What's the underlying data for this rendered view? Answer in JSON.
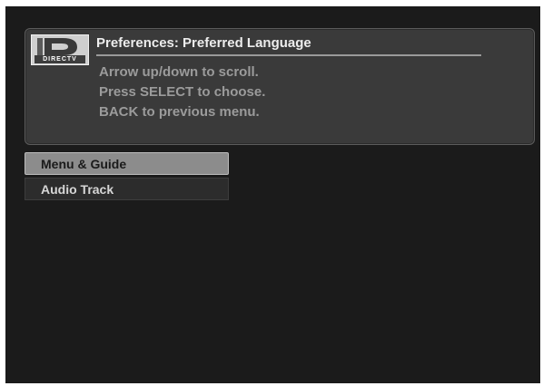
{
  "brand": {
    "logo_text": "DIRECTV"
  },
  "header": {
    "title": "Preferences: Preferred Language",
    "instructions": [
      "Arrow up/down to scroll.",
      "Press SELECT to choose.",
      "BACK to previous menu."
    ]
  },
  "menu": {
    "items": [
      {
        "label": "Menu & Guide",
        "selected": true
      },
      {
        "label": "Audio Track",
        "selected": false
      }
    ]
  },
  "colors": {
    "screen_background": "#1b1b1b",
    "panel_background": "#3a3a3a",
    "selected_item": "#8c8c8c",
    "instruction_text": "#9b9b9b"
  },
  "icons": {
    "logo": "directv-logo-icon"
  }
}
